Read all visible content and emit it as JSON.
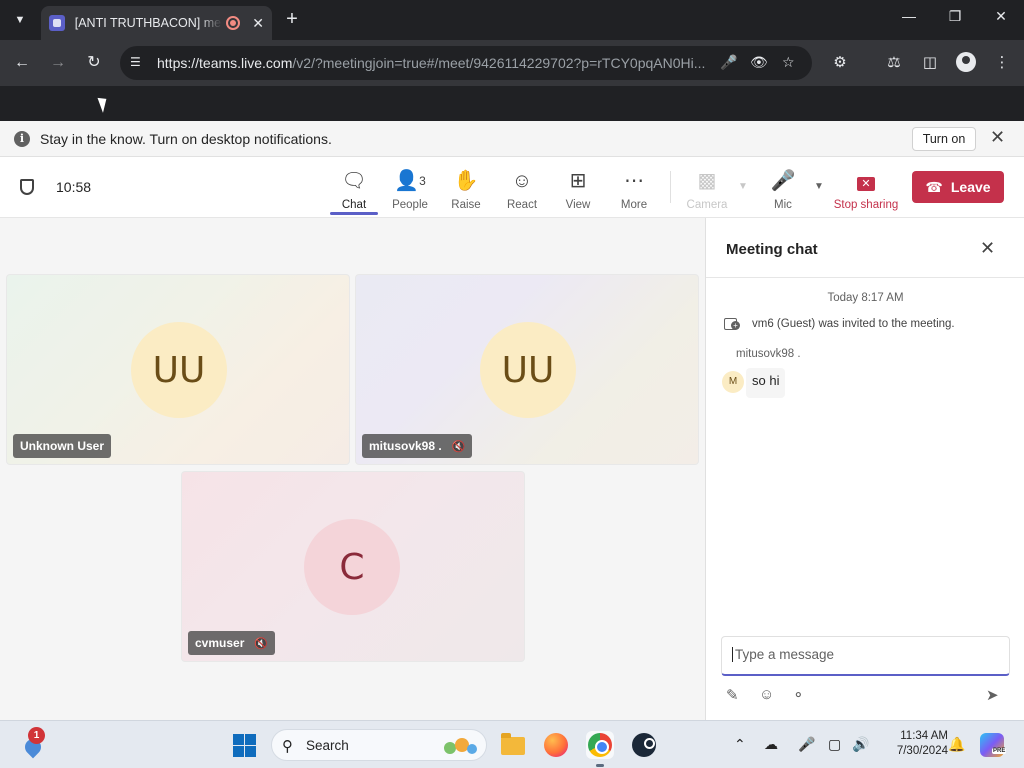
{
  "browser": {
    "tab_title": "[ANTI TRUTHBACON] meeting",
    "url_host": "https://teams.live.com",
    "url_path": "/v2/?meetingjoin=true#/meet/9426114229702?p=rTCY0pqAN0Hi..."
  },
  "notification": {
    "text": "Stay in the know. Turn on desktop notifications.",
    "button": "Turn on"
  },
  "meeting": {
    "timer": "10:58",
    "controls": {
      "chat": "Chat",
      "people": "People",
      "people_count": "3",
      "raise": "Raise",
      "react": "React",
      "view": "View",
      "more": "More",
      "camera": "Camera",
      "mic": "Mic",
      "stop_sharing": "Stop sharing",
      "leave": "Leave"
    }
  },
  "participants": [
    {
      "initials": "UU",
      "name": "Unknown User",
      "muted": false
    },
    {
      "initials": "UU",
      "name": "mitusovk98 .",
      "muted": true
    },
    {
      "initials": "C",
      "name": "cvmuser",
      "muted": true
    }
  ],
  "chat": {
    "title": "Meeting chat",
    "date": "Today 8:17 AM",
    "system_message": "vm6 (Guest) was invited to the meeting.",
    "message": {
      "sender": "mitusovk98 .",
      "avatar_initial": "M",
      "text": "so hi"
    },
    "compose_placeholder": "Type a message"
  },
  "taskbar": {
    "notification_badge": "1",
    "search_label": "Search",
    "time": "11:34 AM",
    "date": "7/30/2024",
    "copilot_badge": "PRE"
  },
  "colors": {
    "accent": "#5b5fc7",
    "leave": "#c4314b",
    "avatar_yellow": "#fbecc4",
    "avatar_pink": "#f4d4d9"
  }
}
